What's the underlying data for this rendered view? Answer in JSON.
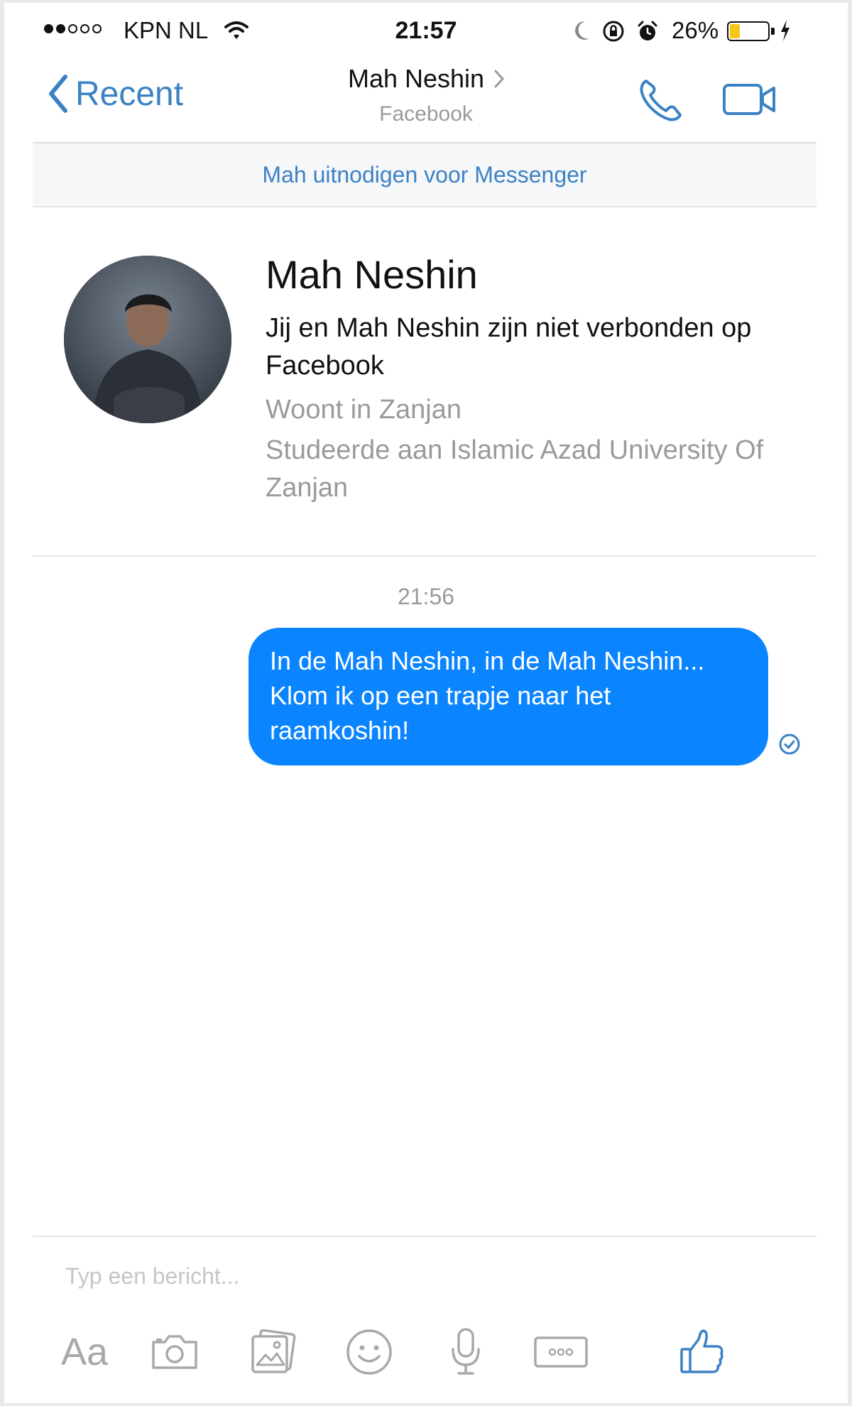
{
  "status_bar": {
    "carrier": "KPN NL",
    "signal_bars_filled": 2,
    "signal_bars_total": 5,
    "time": "21:57",
    "battery_percent": "26%",
    "battery_level": 0.26,
    "battery_fill_color": "#f5c518"
  },
  "nav": {
    "back_label": "Recent",
    "title": "Mah Neshin",
    "subtitle": "Facebook",
    "accent_color": "#3b82c4"
  },
  "banner": {
    "invite_label": "Mah uitnodigen voor Messenger"
  },
  "profile": {
    "name": "Mah Neshin",
    "connection_note": "Jij en Mah Neshin zijn niet verbonden op Facebook",
    "location": "Woont in Zanjan",
    "education": "Studeerde aan Islamic Azad University Of Zanjan"
  },
  "conversation": {
    "timestamp": "21:56",
    "messages": [
      {
        "text": "In de Mah Neshin, in de Mah Neshin... Klom ik op een trapje naar het raamkoshin!",
        "sender": "me",
        "status": "sent",
        "bubble_color": "#0b84ff"
      }
    ]
  },
  "composer": {
    "placeholder": "Typ een bericht...",
    "text_button_label": "Aa",
    "icons": [
      "camera-icon",
      "gallery-icon",
      "emoji-icon",
      "microphone-icon",
      "more-icon",
      "like-icon"
    ]
  }
}
